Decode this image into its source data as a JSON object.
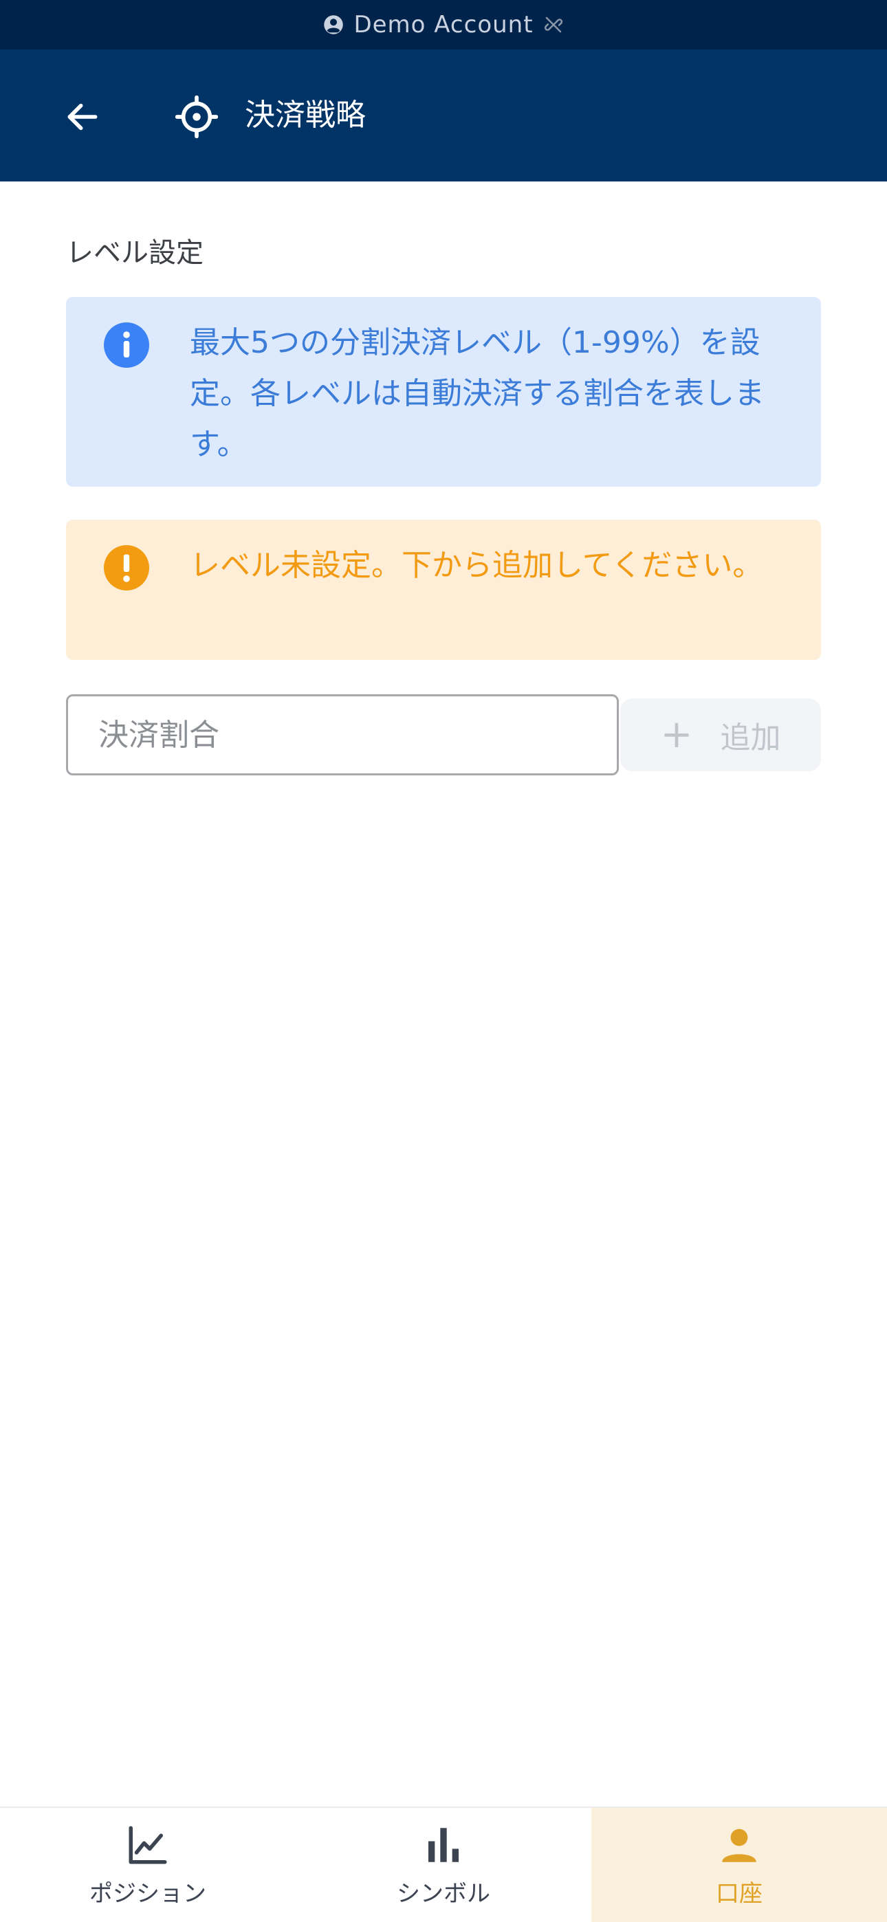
{
  "status_bar": {
    "account_label": "Demo Account",
    "account_icon": "account-circle-icon",
    "link_icon": "link-off-icon"
  },
  "app_bar": {
    "back_icon": "arrow-left-icon",
    "title_icon": "crosshair-target-icon",
    "title": "決済戦略"
  },
  "section": {
    "label": "レベル設定"
  },
  "info": {
    "icon": "info-icon",
    "text": "最大5つの分割決済レベル（1-99%）を設定。各レベルは自動決済する割合を表します。"
  },
  "warning": {
    "icon": "exclamation-icon",
    "text": "レベル未設定。下から追加してください。"
  },
  "form": {
    "input_value": "",
    "input_placeholder": "決済割合",
    "add_label": "追加",
    "add_icon": "plus-icon"
  },
  "bottom_nav": {
    "items": [
      {
        "label": "ポジション",
        "icon": "line-chart-icon",
        "active": false
      },
      {
        "label": "シンボル",
        "icon": "bar-chart-icon",
        "active": false
      },
      {
        "label": "口座",
        "icon": "person-icon",
        "active": true
      }
    ]
  },
  "colors": {
    "status_bar_bg": "#00234b",
    "app_bar_bg": "#003366",
    "info_bg": "#dde9fd",
    "info_accent": "#3b82f6",
    "warning_bg": "#feeed8",
    "warning_accent": "#f29a12",
    "nav_active_bg": "#faf0dc",
    "nav_active_color": "#e0a226"
  }
}
